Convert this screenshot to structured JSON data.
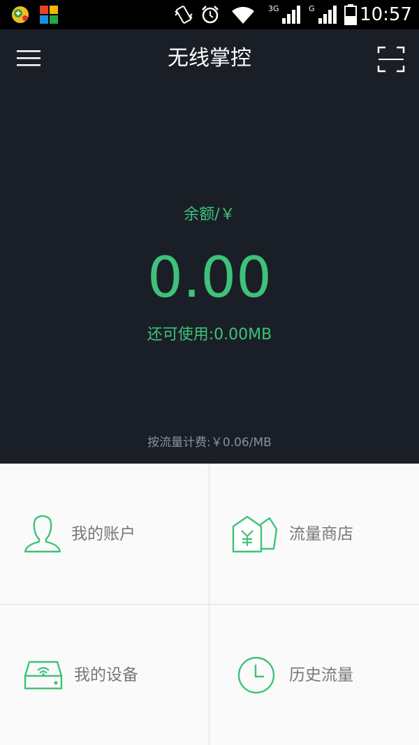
{
  "status_bar": {
    "time": "10:57",
    "network_3g": "3G",
    "network_g": "G",
    "icons": [
      "game-app-icon",
      "colorful-app-icon",
      "vibrate-icon",
      "alarm-icon",
      "wifi-icon",
      "signal-3g-icon",
      "signal-g-icon",
      "battery-icon"
    ]
  },
  "header": {
    "title": "无线掌控",
    "menu_icon": "hamburger-menu-icon",
    "scan_icon": "scan-icon"
  },
  "balance": {
    "label": "余额/￥",
    "value": "0.00",
    "remaining": "还可使用:0.00MB",
    "rate": "按流量计费:￥0.06/MB"
  },
  "grid": {
    "items": [
      {
        "label": "我的账户",
        "icon": "user-icon"
      },
      {
        "label": "流量商店",
        "icon": "shop-icon"
      },
      {
        "label": "我的设备",
        "icon": "router-icon"
      },
      {
        "label": "历史流量",
        "icon": "clock-icon"
      }
    ]
  },
  "colors": {
    "header_bg": "#1a1f27",
    "accent_green": "#3ec27a",
    "grid_bg": "#fafafa"
  }
}
